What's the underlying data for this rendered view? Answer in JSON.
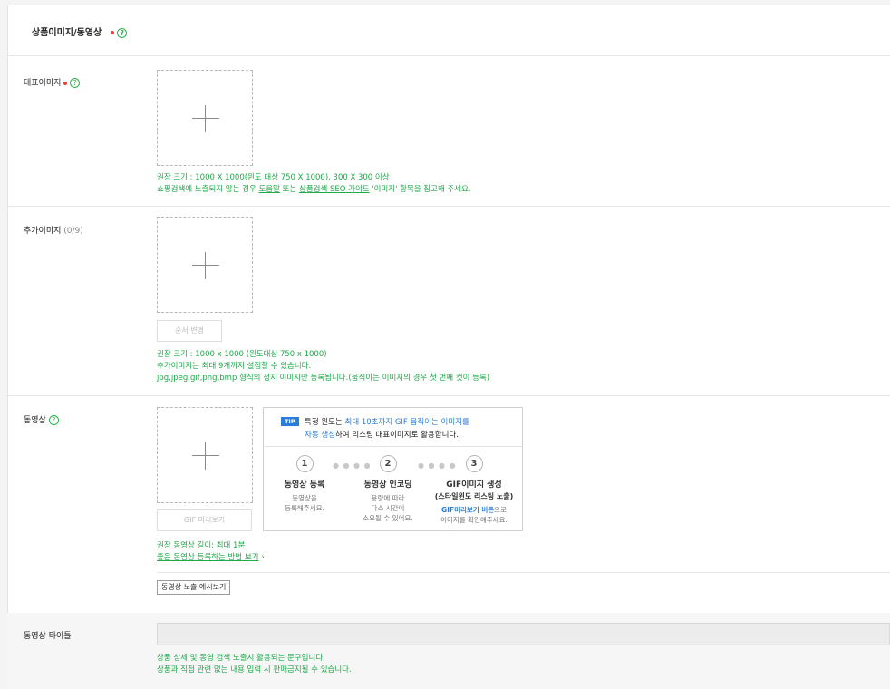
{
  "section": {
    "title": "상품이미지/동영상"
  },
  "main_image": {
    "label": "대표이미지",
    "guide_line1": "권장 크기 : 1000 X 1000(윈도 대상 750 X 1000), 300 X 300 이상",
    "guide_line2_a": "쇼핑검색에 노출되지 않는 경우 ",
    "guide_link1": "도움말",
    "guide_line2_b": " 또는 ",
    "guide_link2": "상품검색 SEO 가이드",
    "guide_line2_c": " '이미지' 항목을 참고해 주세요."
  },
  "extra_image": {
    "label": "추가이미지",
    "count": "(0/9)",
    "reorder_button": "순서 변경",
    "guide_line1": "권장 크기 : 1000 x 1000 (윈도대상 750 x 1000)",
    "guide_line2": "추가이미지는 최대 9개까지 설정할 수 있습니다.",
    "guide_line3": "jpg,jpeg,gif,png,bmp 형식의 정지 이미지만 등록됩니다.(움직이는 이미지의 경우 첫 번째 컷이 등록)"
  },
  "video": {
    "label": "동영상",
    "gif_preview_button": "GIF 미리보기",
    "tip": {
      "badge": "TIP",
      "line1_a": "특정 윈도는 ",
      "line1_b": "최대 10초까지 GIF 움직이는 이미지를",
      "line2_a": "자동 생성",
      "line2_b": "하여 리스팅 대표이미지로 활용합니다.",
      "steps": [
        {
          "num": "1",
          "title": "동영상 등록",
          "sub": "",
          "desc1": "동영상을",
          "desc2": "등록해주세요.",
          "desc3": ""
        },
        {
          "num": "2",
          "title": "동영상 인코딩",
          "sub": "",
          "desc1": "용량에 따라",
          "desc2": "다소 시간이",
          "desc3": "소요될 수 있어요."
        },
        {
          "num": "3",
          "title": "GIF이미지 생성",
          "sub": "(스타일윈도 리스팅 노출)",
          "desc1_blue": "GIF미리보기 버튼",
          "desc1": "으로",
          "desc2": "이미지를 확인해주세요.",
          "desc3": ""
        }
      ],
      "dots": "● ● ● ●"
    },
    "guide_line1": "권장 동영상 길이: 최대 1분",
    "guide_link": "좋은 동영상 등록하는 방법 보기",
    "guide_arrow": "›",
    "exposure_preview_button": "동영상 노출 예시보기"
  },
  "video_title": {
    "label": "동영상 타이틀",
    "input_value": "",
    "guide_line1": "상품 상세 및 동영 검색 노출시 활용되는 문구입니다.",
    "guide_line2": "상품과 직접 관련 없는 내용 입력 시 판매금지될 수 있습니다."
  },
  "icons": {
    "required": "required-dot",
    "help": "help-circle-icon",
    "add": "plus-icon"
  },
  "colors": {
    "accent_green": "#1ea94a",
    "required_red": "#f23c3c",
    "tip_blue": "#2a7ed8"
  }
}
